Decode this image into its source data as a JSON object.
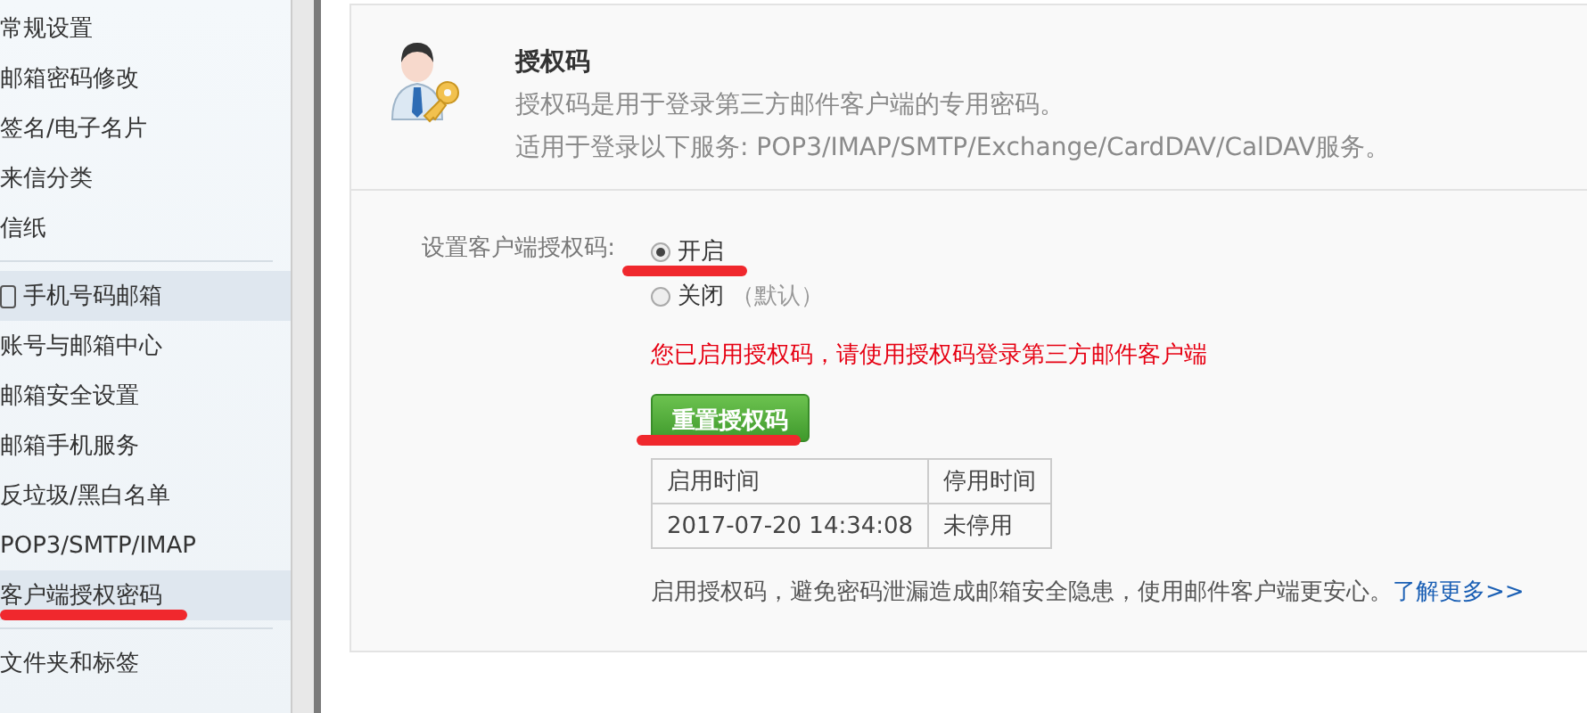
{
  "sidebar": {
    "items": [
      {
        "label": "常规设置",
        "kind": "item",
        "selected": false,
        "marked": false
      },
      {
        "label": "邮箱密码修改",
        "kind": "item",
        "selected": false,
        "marked": false
      },
      {
        "label": "签名/电子名片",
        "kind": "item",
        "selected": false,
        "marked": false
      },
      {
        "label": "来信分类",
        "kind": "item",
        "selected": false,
        "marked": false
      },
      {
        "label": "信纸",
        "kind": "item",
        "selected": false,
        "marked": false
      },
      {
        "kind": "divider"
      },
      {
        "label": "手机号码邮箱",
        "kind": "header",
        "selected": false,
        "marked": false
      },
      {
        "label": "账号与邮箱中心",
        "kind": "item",
        "selected": false,
        "marked": false
      },
      {
        "label": "邮箱安全设置",
        "kind": "item",
        "selected": false,
        "marked": false
      },
      {
        "label": "邮箱手机服务",
        "kind": "item",
        "selected": false,
        "marked": false
      },
      {
        "label": "反垃圾/黑白名单",
        "kind": "item",
        "selected": false,
        "marked": false
      },
      {
        "label": "POP3/SMTP/IMAP",
        "kind": "item",
        "selected": false,
        "marked": false
      },
      {
        "label": "客户端授权密码",
        "kind": "item",
        "selected": true,
        "marked": true
      },
      {
        "kind": "divider"
      },
      {
        "label": "文件夹和标签",
        "kind": "item",
        "selected": false,
        "marked": false
      }
    ]
  },
  "header": {
    "title": "授权码",
    "lines": [
      "授权码是用于登录第三方邮件客户端的专用密码。",
      "适用于登录以下服务: POP3/IMAP/SMTP/Exchange/CardDAV/CalDAV服务。"
    ]
  },
  "setting": {
    "label": "设置客户端授权码:",
    "options": [
      {
        "label": "开启",
        "selected": true,
        "marked": true
      },
      {
        "label": "关闭",
        "note": "（默认）",
        "selected": false,
        "marked": false
      }
    ]
  },
  "notice": "您已启用授权码，请使用授权码登录第三方邮件客户端",
  "reset_button": {
    "label": "重置授权码",
    "marked": true
  },
  "table": {
    "columns": [
      "启用时间",
      "停用时间"
    ],
    "rows": [
      [
        "2017-07-20 14:34:08",
        "未停用"
      ]
    ]
  },
  "footer": {
    "text": "启用授权码，避免密码泄漏造成邮箱安全隐患，使用邮件客户端更安心。",
    "link": "了解更多>>"
  }
}
